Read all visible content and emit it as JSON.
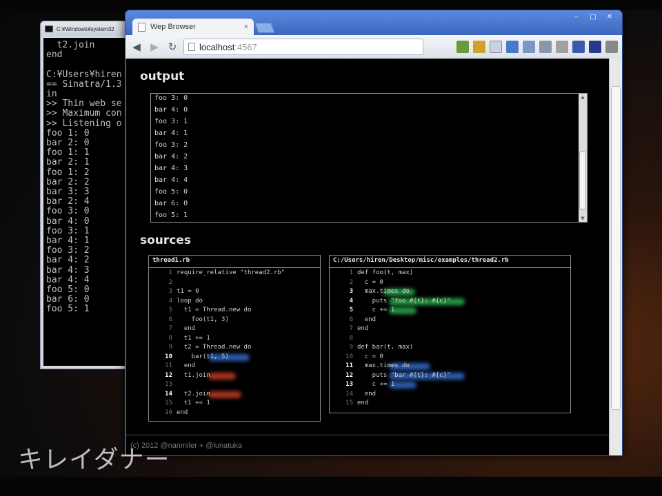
{
  "console": {
    "title": "C:¥Windows¥system32",
    "lines": [
      "  t2.join",
      "end",
      "",
      "C:¥Users¥hiren",
      "== Sinatra/1.3",
      "in",
      ">> Thin web se",
      ">> Maximum con",
      ">> Listening o",
      "foo 1: 0",
      "bar 2: 0",
      "foo 1: 1",
      "bar 2: 1",
      "foo 1: 2",
      "bar 2: 2",
      "bar 3: 3",
      "bar 2: 4",
      "foo 3: 0",
      "bar 4: 0",
      "foo 3: 1",
      "bar 4: 1",
      "foo 3: 2",
      "bar 4: 2",
      "bar 4: 3",
      "bar 4: 4",
      "foo 5: 0",
      "bar 6: 0",
      "foo 5: 1"
    ]
  },
  "browser": {
    "tab_title": "Wep Browser",
    "tab_close": "×",
    "url_host": "localhost",
    "url_port": ":4567",
    "back": "◀",
    "forward": "▶",
    "reload": "↻",
    "minimize": "–",
    "maximize": "□",
    "close": "✕"
  },
  "output": {
    "title": "output",
    "lines": [
      "foo 3: 0",
      "bar 4: 0",
      "foo 3: 1",
      "bar 4: 1",
      "foo 3: 2",
      "bar 4: 2",
      "bar 4: 3",
      "bar 4: 4",
      "foo 5: 0",
      "bar 6: 0",
      "foo 5: 1"
    ]
  },
  "sources": {
    "title": "sources",
    "left": {
      "filename": "thread1.rb",
      "lines": [
        {
          "n": "1",
          "code": "require_relative \"thread2.rb\""
        },
        {
          "n": "2",
          "code": ""
        },
        {
          "n": "3",
          "code": "t1 = 0"
        },
        {
          "n": "4",
          "code": "loop do"
        },
        {
          "n": "5",
          "code": "  t1 = Thread.new do"
        },
        {
          "n": "6",
          "code": "    foo(t1, 3)"
        },
        {
          "n": "7",
          "code": "  end"
        },
        {
          "n": "8",
          "code": "  t1 += 1"
        },
        {
          "n": "9",
          "code": "  t2 = Thread.new do"
        },
        {
          "n": "10",
          "code": "    bar(t1, 5)"
        },
        {
          "n": "11",
          "code": "  end"
        },
        {
          "n": "12",
          "code": "  t1.join"
        },
        {
          "n": "13",
          "code": ""
        },
        {
          "n": "14",
          "code": "  t2.join"
        },
        {
          "n": "15",
          "code": "  t1 += 1"
        },
        {
          "n": "16",
          "code": "end"
        }
      ]
    },
    "right": {
      "filename": "C:/Users/hiren/Desktop/misc/examples/thread2.rb",
      "lines": [
        {
          "n": "1",
          "code": "def foo(t, max)"
        },
        {
          "n": "2",
          "code": "  c = 0"
        },
        {
          "n": "3",
          "code": "  max.times do"
        },
        {
          "n": "4",
          "code": "    puts \"foo #{t}: #{c}\""
        },
        {
          "n": "5",
          "code": "    c += 1"
        },
        {
          "n": "6",
          "code": "  end"
        },
        {
          "n": "7",
          "code": "end"
        },
        {
          "n": "8",
          "code": ""
        },
        {
          "n": "9",
          "code": "def bar(t, max)"
        },
        {
          "n": "10",
          "code": "  c = 0"
        },
        {
          "n": "11",
          "code": "  max.times do"
        },
        {
          "n": "12",
          "code": "    puts \"bar #{t}: #{c}\""
        },
        {
          "n": "13",
          "code": "    c += 1"
        },
        {
          "n": "14",
          "code": "  end"
        },
        {
          "n": "15",
          "code": "end"
        }
      ]
    }
  },
  "footer": "(c) 2012 @nanmiler + @lunatuka",
  "caption": "キレイダナー",
  "colors": {
    "highlight_red": "#e0462a",
    "highlight_blue": "#3a7ae8",
    "highlight_green": "#32c85a"
  }
}
